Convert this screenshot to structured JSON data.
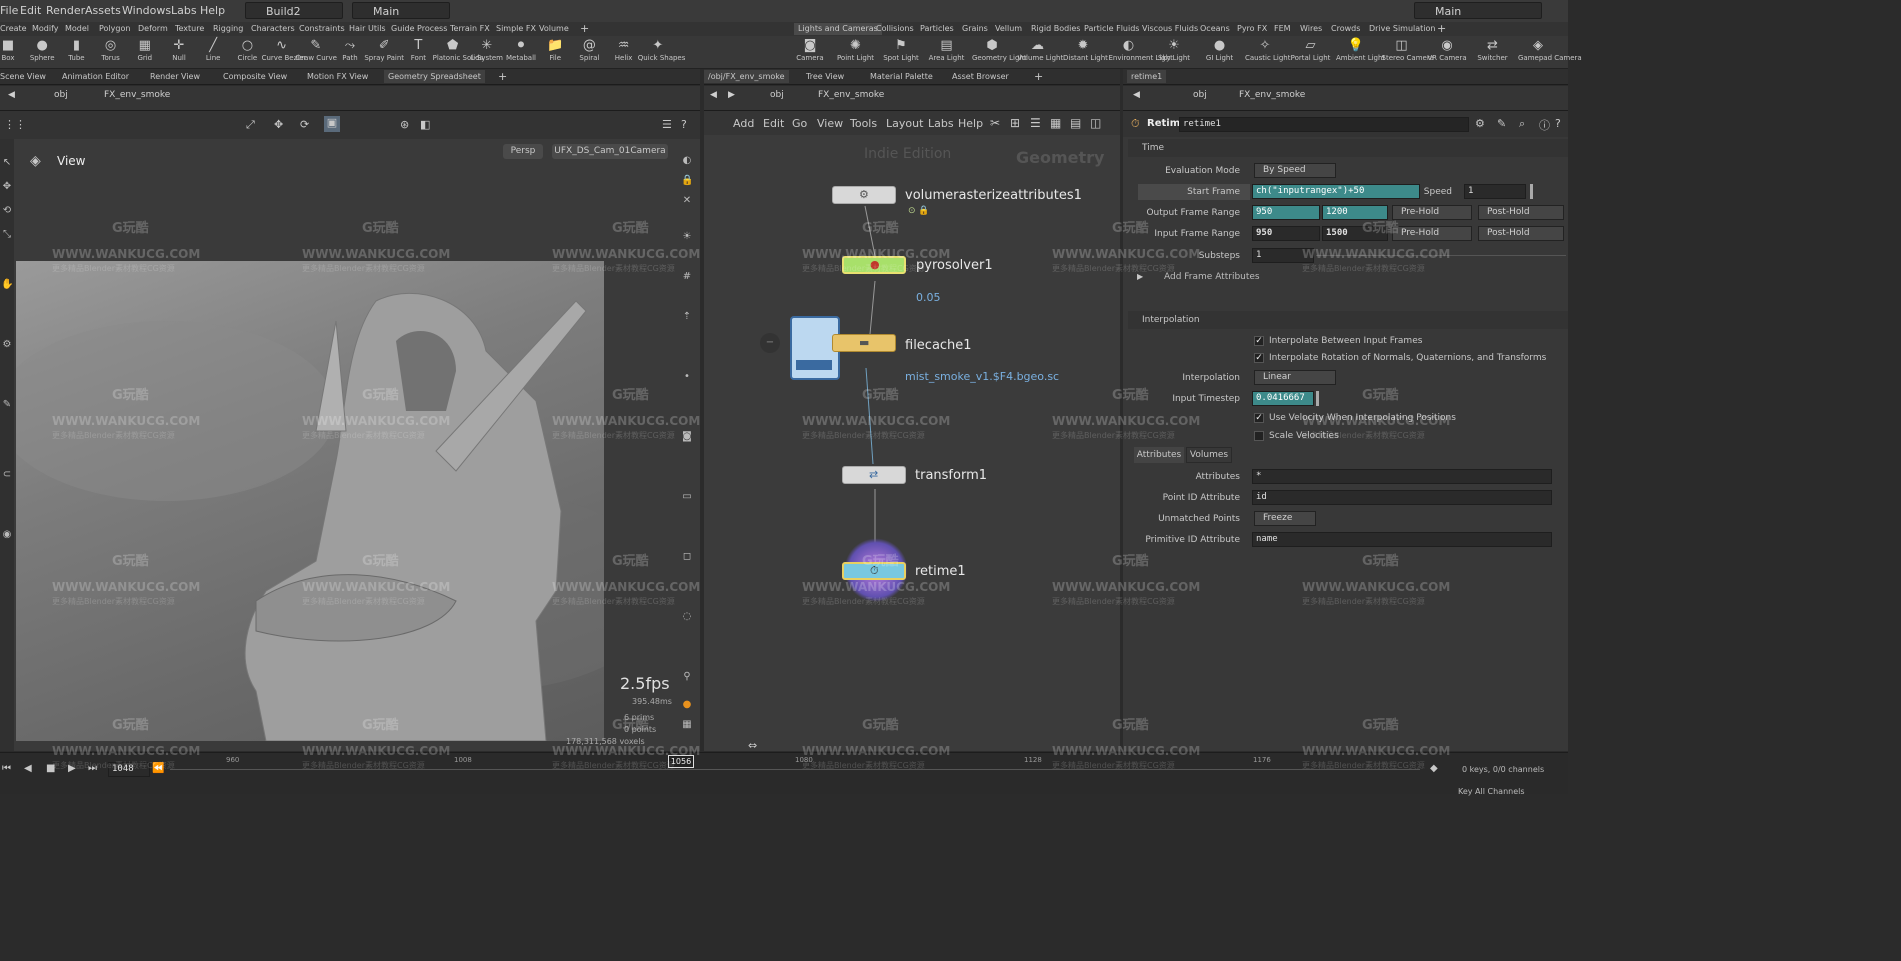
{
  "menu": {
    "items": [
      "File",
      "Edit",
      "Render",
      "Assets",
      "Windows",
      "Labs",
      "Help"
    ],
    "desktop": "Build2",
    "context": "Main",
    "context_right": "Main"
  },
  "shelf_tabs_left": [
    "Create",
    "Modify",
    "Model",
    "Polygon",
    "Deform",
    "Texture",
    "Rigging",
    "Characters",
    "Constraints",
    "Hair Utils",
    "Guide Process",
    "Terrain FX",
    "Simple FX",
    "Volume"
  ],
  "shelf_tabs_right": [
    "Lights and Cameras",
    "Collisions",
    "Particles",
    "Grains",
    "Vellum",
    "Rigid Bodies",
    "Particle Fluids",
    "Viscous Fluids",
    "Oceans",
    "Pyro FX",
    "FEM",
    "Wires",
    "Crowds",
    "Drive Simulation"
  ],
  "tools_left": [
    {
      "label": "Box",
      "icon": "box-icon",
      "glyph": "■"
    },
    {
      "label": "Sphere",
      "icon": "sphere-icon",
      "glyph": "●"
    },
    {
      "label": "Tube",
      "icon": "tube-icon",
      "glyph": "▮"
    },
    {
      "label": "Torus",
      "icon": "torus-icon",
      "glyph": "◎"
    },
    {
      "label": "Grid",
      "icon": "grid-icon",
      "glyph": "▦"
    },
    {
      "label": "Null",
      "icon": "null-icon",
      "glyph": "✛"
    },
    {
      "label": "Line",
      "icon": "line-icon",
      "glyph": "╱"
    },
    {
      "label": "Circle",
      "icon": "circle-icon",
      "glyph": "○"
    },
    {
      "label": "Curve Bezier",
      "icon": "curve-bezier-icon",
      "glyph": "∿"
    },
    {
      "label": "Draw Curve",
      "icon": "draw-curve-icon",
      "glyph": "✎"
    },
    {
      "label": "Path",
      "icon": "path-icon",
      "glyph": "⤳"
    },
    {
      "label": "Spray Paint",
      "icon": "spray-paint-icon",
      "glyph": "✐"
    },
    {
      "label": "Font",
      "icon": "font-icon",
      "glyph": "T"
    },
    {
      "label": "Platonic Solids",
      "icon": "platonic-icon",
      "glyph": "⬟"
    },
    {
      "label": "L-System",
      "icon": "l-system-icon",
      "glyph": "✳"
    },
    {
      "label": "Metaball",
      "icon": "metaball-icon",
      "glyph": "⚫"
    },
    {
      "label": "File",
      "icon": "file-icon",
      "glyph": "📁"
    },
    {
      "label": "Spiral",
      "icon": "spiral-icon",
      "glyph": "@"
    },
    {
      "label": "Helix",
      "icon": "helix-icon",
      "glyph": "♒"
    },
    {
      "label": "Quick Shapes",
      "icon": "quick-shapes-icon",
      "glyph": "✦"
    }
  ],
  "tools_right": [
    {
      "label": "Camera",
      "icon": "camera-icon",
      "glyph": "◙"
    },
    {
      "label": "Point Light",
      "icon": "point-light-icon",
      "glyph": "✺"
    },
    {
      "label": "Spot Light",
      "icon": "spot-light-icon",
      "glyph": "⚑"
    },
    {
      "label": "Area Light",
      "icon": "area-light-icon",
      "glyph": "▤"
    },
    {
      "label": "Geometry Light",
      "icon": "geometry-light-icon",
      "glyph": "⬢"
    },
    {
      "label": "Volume Light",
      "icon": "volume-light-icon",
      "glyph": "☁"
    },
    {
      "label": "Distant Light",
      "icon": "distant-light-icon",
      "glyph": "✹"
    },
    {
      "label": "Environment Light",
      "icon": "environment-light-icon",
      "glyph": "◐"
    },
    {
      "label": "Sky Light",
      "icon": "sky-light-icon",
      "glyph": "☀"
    },
    {
      "label": "GI Light",
      "icon": "gi-light-icon",
      "glyph": "●"
    },
    {
      "label": "Caustic Light",
      "icon": "caustic-light-icon",
      "glyph": "✧"
    },
    {
      "label": "Portal Light",
      "icon": "portal-light-icon",
      "glyph": "▱"
    },
    {
      "label": "Ambient Light",
      "icon": "ambient-light-icon",
      "glyph": "💡"
    },
    {
      "label": "Stereo Camera",
      "icon": "stereo-camera-icon",
      "glyph": "◫"
    },
    {
      "label": "VR Camera",
      "icon": "vr-camera-icon",
      "glyph": "◉"
    },
    {
      "label": "Switcher",
      "icon": "switcher-icon",
      "glyph": "⇄"
    },
    {
      "label": "Gamepad Camera",
      "icon": "gamepad-camera-icon",
      "glyph": "◈"
    }
  ],
  "left_tabs": [
    "Scene View",
    "Animation Editor",
    "Render View",
    "Composite View",
    "Motion FX View",
    "Geometry Spreadsheet"
  ],
  "mid_tabs": [
    "/obj/FX_env_smoke",
    "Tree View",
    "Material Palette",
    "Asset Browser"
  ],
  "right_tabs": [
    "retime1"
  ],
  "path": {
    "root": "obj",
    "node": "FX_env_smoke"
  },
  "viewport": {
    "title": "View",
    "persp": "Persp",
    "camera": "UFX_DS_Cam_01Camera",
    "fps": "2.5fps",
    "ms": "395.48ms",
    "stats": [
      "6 prims",
      "0 points",
      "178,311,568 voxels"
    ]
  },
  "network": {
    "menu": [
      "Add",
      "Edit",
      "Go",
      "View",
      "Tools",
      "Layout",
      "Labs",
      "Help"
    ],
    "edition": "Indie Edition",
    "context_label": "Geometry",
    "nodes": [
      {
        "name": "volumerasterizeattributes1",
        "sub": ""
      },
      {
        "name": "pyrosolver1",
        "sub": "0.05"
      },
      {
        "name": "filecache1",
        "sub": "mist_smoke_v1.$F4.bgeo.sc"
      },
      {
        "name": "transform1",
        "sub": ""
      },
      {
        "name": "retime1",
        "sub": ""
      }
    ]
  },
  "params": {
    "node_type": "Retime",
    "node_name": "retime1",
    "section_time": "Time",
    "eval_mode_label": "Evaluation Mode",
    "eval_mode": "By Speed",
    "start_frame_label": "Start Frame",
    "start_frame": "ch(\"inputrangex\")+50",
    "speed_label": "Speed",
    "speed": "1",
    "output_range_label": "Output Frame Range",
    "output_start": "950",
    "output_end": "1200",
    "pre_hold": "Pre-Hold",
    "post_hold": "Post-Hold",
    "input_range_label": "Input Frame Range",
    "input_start": "950",
    "input_end": "1500",
    "substeps_label": "Substeps",
    "substeps": "1",
    "add_frame_attrs": "Add Frame Attributes",
    "section_interp": "Interpolation",
    "chk_interp_inputs": "Interpolate Between Input Frames",
    "chk_interp_rot": "Interpolate Rotation of Normals, Quaternions, and Transforms",
    "interp_label": "Interpolation",
    "interp": "Linear",
    "timestep_label": "Input Timestep",
    "timestep": "0.0416667",
    "chk_velocity": "Use Velocity When Interpolating Positions",
    "chk_scale_vel": "Scale Velocities",
    "subtabs": [
      "Attributes",
      "Volumes"
    ],
    "attributes_label": "Attributes",
    "attributes": "*",
    "pointid_label": "Point ID Attribute",
    "pointid": "id",
    "unmatched_label": "Unmatched Points",
    "unmatched": "Freeze",
    "primid_label": "Primitive ID Attribute",
    "primid": "name"
  },
  "timeline": {
    "current": "1048",
    "marker": "1056",
    "ticks": [
      "960",
      "1008",
      "1056",
      "1080",
      "1128",
      "1176"
    ],
    "keys": "0 keys, 0/0 channels",
    "key_all": "Key All Channels"
  },
  "watermark": {
    "logo": "G玩酷",
    "site": "WWW.WANKUCG.COM",
    "sub": "更多精品Blender素材教程CG资源"
  }
}
